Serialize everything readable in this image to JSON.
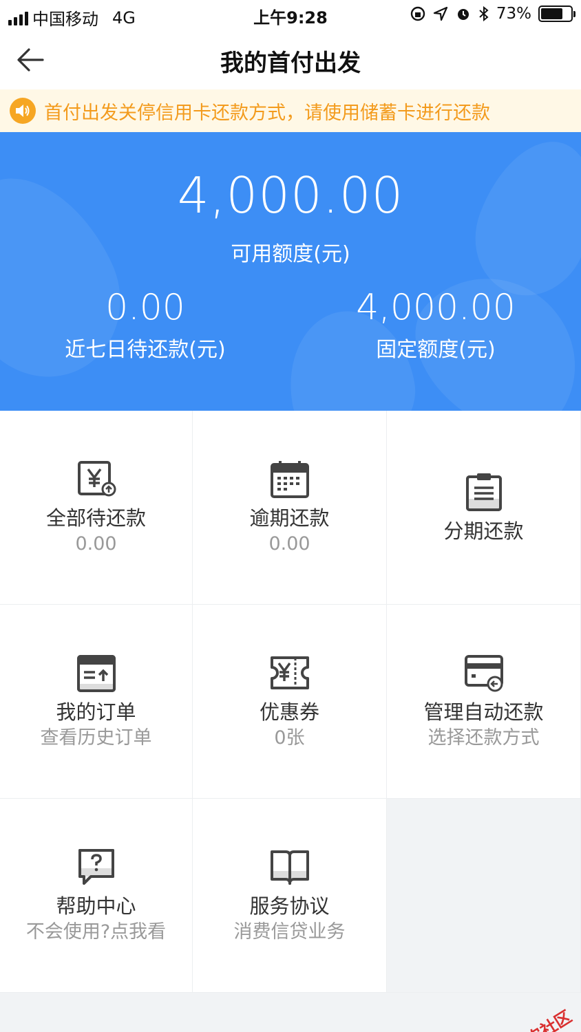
{
  "status_bar": {
    "carrier": "中国移动",
    "network": "4G",
    "time": "上午9:28",
    "battery": "73%",
    "battery_level": 0.73
  },
  "nav": {
    "title": "我的首付出发",
    "back_icon": "arrow-left-icon"
  },
  "notice": {
    "icon": "speaker-icon",
    "text": "首付出发关停信用卡还款方式，请使用储蓄卡进行还款"
  },
  "hero": {
    "available_amount": "4,000.00",
    "available_label": "可用额度(元)",
    "due_amount": "0.00",
    "due_label": "近七日待还款(元)",
    "fixed_amount": "4,000.00",
    "fixed_label": "固定额度(元)"
  },
  "grid": [
    {
      "title": "全部待还款",
      "sub": "0.00",
      "icon": "yuan-bill-icon"
    },
    {
      "title": "逾期还款",
      "sub": "0.00",
      "icon": "calendar-icon"
    },
    {
      "title": "分期还款",
      "sub": "",
      "icon": "clipboard-icon"
    },
    {
      "title": "我的订单",
      "sub": "查看历史订单",
      "icon": "order-icon"
    },
    {
      "title": "优惠券",
      "sub": "0张",
      "icon": "coupon-icon"
    },
    {
      "title": "管理自动还款",
      "sub": "选择还款方式",
      "icon": "card-icon"
    },
    {
      "title": "帮助中心",
      "sub": "不会使用?点我看",
      "icon": "help-icon"
    },
    {
      "title": "服务协议",
      "sub": "消费信贷业务",
      "icon": "book-icon"
    }
  ],
  "watermark": "卡农社区",
  "colors": {
    "hero_blue": "#3d8ef5",
    "notice_bg": "#fff8e6",
    "notice_text": "#f39b1d",
    "watermark": "#d93030"
  }
}
